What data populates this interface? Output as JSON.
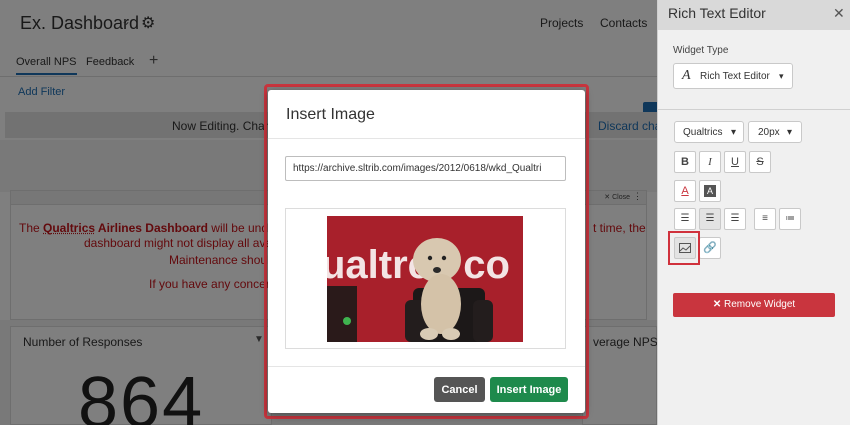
{
  "dashboard": {
    "title": "Ex. Dashboard",
    "title_caret": "⌄",
    "nav": [
      "Projects",
      "Contacts"
    ],
    "tabs": [
      "Overall NPS",
      "Feedback"
    ],
    "add_tab": "+",
    "add_filter": "Add Filter",
    "banner_text": "Now Editing. Chan",
    "banner_discard": "Discard chan",
    "widget_close": "✕ Close",
    "notice": {
      "line1_pre": "The ",
      "line1_link": "Qualtrics",
      "line1_bold": " Airlines Dashboard",
      "line1_post": " will be under",
      "line1_right": "t time, the",
      "line2": "dashboard might not display all avai",
      "line3": "Maintenance shoul",
      "line4": "If you have any concern"
    },
    "card_left_title": "Number of Responses",
    "card_right_title": "verage NPS",
    "responses_value": "864"
  },
  "panel": {
    "title": "Rich Text Editor",
    "widget_type_label": "Widget Type",
    "widget_type_value": "Rich Text Editor",
    "font_family": "Qualtrics",
    "font_size": "20px",
    "remove_widget": "Remove Widget"
  },
  "modal": {
    "title": "Insert Image",
    "url": "https://archive.sltrib.com/images/2012/0618/wkd_Qualtri",
    "image_text": "ualtrcs co",
    "cancel": "Cancel",
    "insert": "Insert Image"
  },
  "colors": {
    "accent_red": "#c9353e",
    "insert_green": "#1e8a4c",
    "link_blue": "#1f6fb5",
    "notice_red": "#c7141a"
  }
}
